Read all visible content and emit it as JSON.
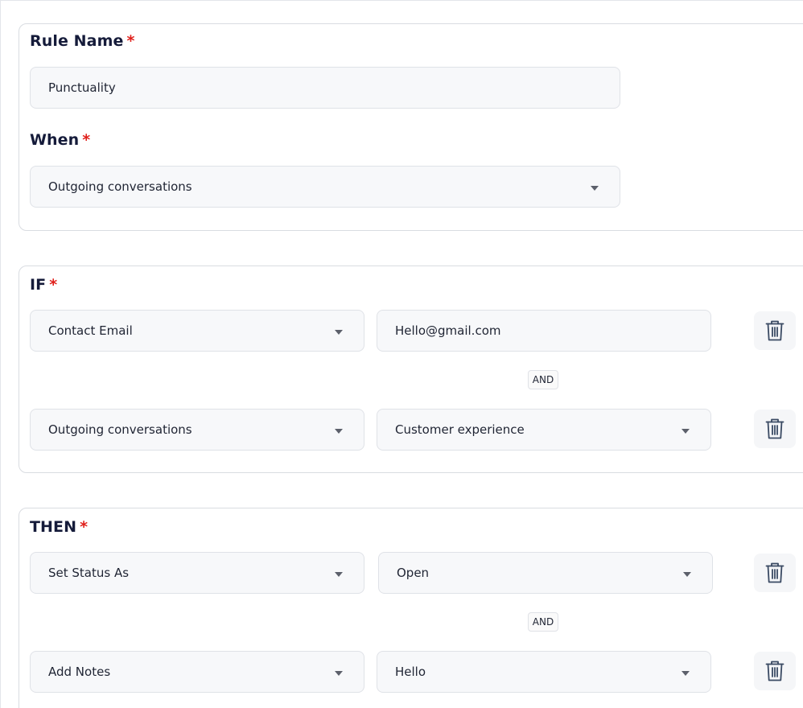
{
  "rule_name": {
    "label": "Rule Name",
    "required_mark": "*",
    "value": "Punctuality"
  },
  "when": {
    "label": "When",
    "required_mark": "*",
    "selected": "Outgoing conversations"
  },
  "if_section": {
    "label": "IF",
    "required_mark": "*",
    "connector": "AND",
    "conditions": [
      {
        "field": "Contact Email",
        "value": "Hello@gmail.com",
        "delete_icon": "trash-icon"
      },
      {
        "field": "Outgoing conversations",
        "value": "Customer experience",
        "delete_icon": "trash-icon"
      }
    ]
  },
  "then_section": {
    "label": "THEN",
    "required_mark": "*",
    "connector": "AND",
    "actions": [
      {
        "action": "Set Status As",
        "value": "Open",
        "delete_icon": "trash-icon"
      },
      {
        "action": "Add Notes",
        "value": "Hello",
        "delete_icon": "trash-icon"
      }
    ]
  },
  "colors": {
    "required": "#e0201b",
    "heading": "#151b3a",
    "field_bg": "#f7f8fa",
    "field_border": "#dfe2e7",
    "icon": "#3a4a63"
  }
}
